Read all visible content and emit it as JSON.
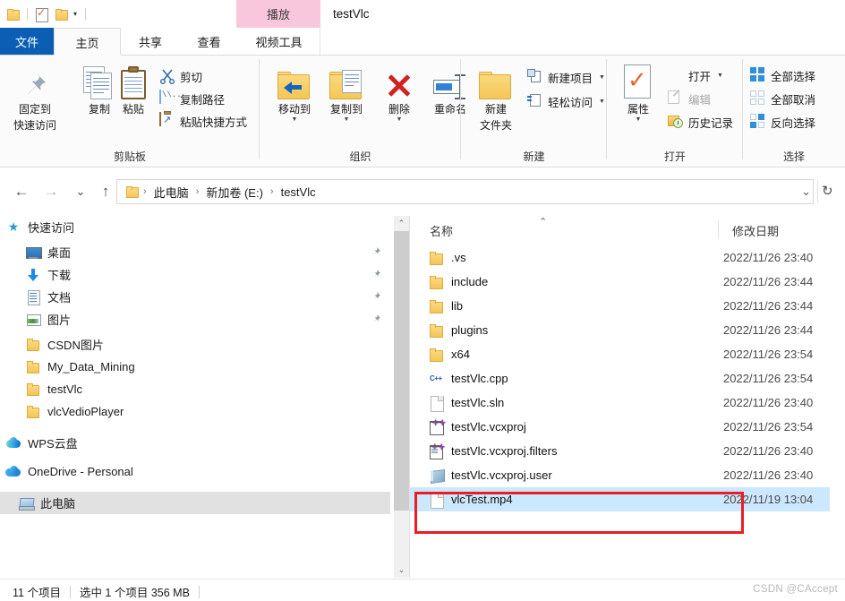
{
  "titlebar": {
    "qat": {
      "folder_icon": "folder-icon",
      "properties_icon": "properties-checkmark-icon",
      "new_folder_icon": "new-folder-icon",
      "customize_caret": "▾"
    },
    "contextual_tab": "播放",
    "window_title": "testVlc"
  },
  "ribbon_tabs": [
    {
      "id": "file",
      "label": "文件"
    },
    {
      "id": "home",
      "label": "主页"
    },
    {
      "id": "share",
      "label": "共享"
    },
    {
      "id": "view",
      "label": "查看"
    },
    {
      "id": "videotools",
      "label": "视频工具"
    }
  ],
  "ribbon": {
    "groups": [
      {
        "id": "clipboard",
        "label": "剪贴板"
      },
      {
        "id": "organize",
        "label": "组织"
      },
      {
        "id": "new",
        "label": "新建"
      },
      {
        "id": "open",
        "label": "打开"
      },
      {
        "id": "select",
        "label": "选择"
      }
    ],
    "clipboard": {
      "pin": {
        "line1": "固定到",
        "line2": "快速访问"
      },
      "copy": "复制",
      "paste": "粘贴",
      "cut": "剪切",
      "copy_path": "复制路径",
      "paste_shortcut": "粘贴快捷方式"
    },
    "organize": {
      "move_to": "移动到",
      "copy_to": "复制到",
      "delete": "删除",
      "rename": "重命名"
    },
    "new": {
      "new_folder_line1": "新建",
      "new_folder_line2": "文件夹",
      "new_item": "新建项目",
      "easy_access": "轻松访问"
    },
    "open": {
      "properties": "属性",
      "open": "打开",
      "edit": "编辑",
      "history": "历史记录"
    },
    "select": {
      "select_all": "全部选择",
      "select_none": "全部取消",
      "invert_selection": "反向选择"
    }
  },
  "addressbar": {
    "back": "←",
    "forward": "→",
    "recent": "⌄",
    "up": "↑",
    "crumbs": [
      "此电脑",
      "新加卷 (E:)",
      "testVlc"
    ],
    "separator": "›",
    "dropdown_caret": "⌄",
    "refresh": "↻"
  },
  "sidebar": {
    "items": [
      {
        "label": "快速访问",
        "icon": "star-icon",
        "indent": 6,
        "pinned": false,
        "selected": false
      },
      {
        "label": "桌面",
        "icon": "desktop-icon",
        "indent": 28,
        "pinned": true,
        "selected": false
      },
      {
        "label": "下载",
        "icon": "download-icon",
        "indent": 28,
        "pinned": true,
        "selected": false
      },
      {
        "label": "文档",
        "icon": "documents-icon",
        "indent": 28,
        "pinned": true,
        "selected": false
      },
      {
        "label": "图片",
        "icon": "pictures-icon",
        "indent": 28,
        "pinned": true,
        "selected": false
      },
      {
        "label": "CSDN图片",
        "icon": "folder-icon",
        "indent": 28,
        "pinned": false,
        "selected": false
      },
      {
        "label": "My_Data_Mining",
        "icon": "folder-icon",
        "indent": 28,
        "pinned": false,
        "selected": false
      },
      {
        "label": "testVlc",
        "icon": "folder-icon",
        "indent": 28,
        "pinned": false,
        "selected": false
      },
      {
        "label": "vlcVedioPlayer",
        "icon": "folder-icon",
        "indent": 28,
        "pinned": false,
        "selected": false
      },
      {
        "label": "WPS云盘",
        "icon": "wps-cloud-icon",
        "indent": 6,
        "pinned": false,
        "selected": false
      },
      {
        "label": "OneDrive - Personal",
        "icon": "onedrive-icon",
        "indent": 6,
        "pinned": false,
        "selected": false
      },
      {
        "label": "此电脑",
        "icon": "this-pc-icon",
        "indent": 20,
        "pinned": false,
        "selected": true
      }
    ],
    "scroll_up": "⌃",
    "scroll_down": "⌄"
  },
  "filelist": {
    "columns": {
      "name": "名称",
      "date": "修改日期"
    },
    "sort_indicator": "⌃",
    "rows": [
      {
        "name": ".vs",
        "date": "2022/11/26 23:40",
        "icon": "folder-icon",
        "selected": false
      },
      {
        "name": "include",
        "date": "2022/11/26 23:44",
        "icon": "folder-icon",
        "selected": false
      },
      {
        "name": "lib",
        "date": "2022/11/26 23:44",
        "icon": "folder-icon",
        "selected": false
      },
      {
        "name": "plugins",
        "date": "2022/11/26 23:44",
        "icon": "folder-icon",
        "selected": false
      },
      {
        "name": "x64",
        "date": "2022/11/26 23:54",
        "icon": "folder-icon",
        "selected": false
      },
      {
        "name": "testVlc.cpp",
        "date": "2022/11/26 23:54",
        "icon": "cpp-file-icon",
        "selected": false
      },
      {
        "name": "testVlc.sln",
        "date": "2022/11/26 23:40",
        "icon": "generic-file-icon",
        "selected": false
      },
      {
        "name": "testVlc.vcxproj",
        "date": "2022/11/26 23:54",
        "icon": "vcxproj-icon",
        "selected": false
      },
      {
        "name": "testVlc.vcxproj.filters",
        "date": "2022/11/26 23:40",
        "icon": "vcxproj-filters-icon",
        "selected": false
      },
      {
        "name": "testVlc.vcxproj.user",
        "date": "2022/11/26 23:40",
        "icon": "vcxproj-user-icon",
        "selected": false
      },
      {
        "name": "vlcTest.mp4",
        "date": "2022/11/19 13:04",
        "icon": "generic-file-icon",
        "selected": true
      }
    ]
  },
  "annotation": {
    "highlight_color": "#ec1c24",
    "target_row": "vlcTest.mp4"
  },
  "statusbar": {
    "item_count": "11 个项目",
    "selection": "选中 1 个项目  356 MB",
    "watermark": "CSDN @CAccept"
  },
  "colors": {
    "file_tab_blue": "#0a5fb4",
    "contextual_pink": "#f9c7dc",
    "selection_blue": "#cce8ff",
    "nav_selected_gray": "#e1e1e1"
  }
}
